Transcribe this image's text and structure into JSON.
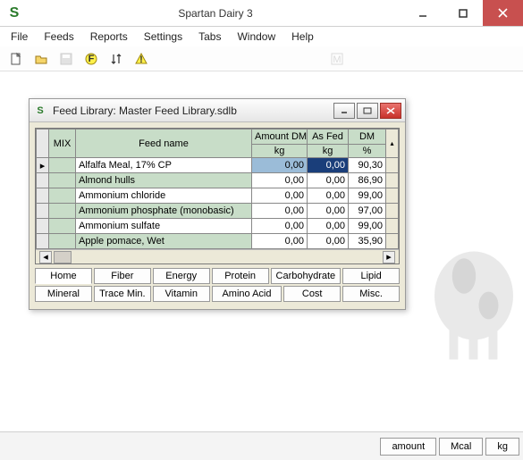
{
  "app": {
    "title": "Spartan Dairy 3",
    "logo": "S"
  },
  "menu": [
    "File",
    "Feeds",
    "Reports",
    "Settings",
    "Tabs",
    "Window",
    "Help"
  ],
  "child": {
    "title": "Feed Library:  Master Feed Library.sdlb",
    "headers": {
      "mix": "MIX",
      "feedname": "Feed name",
      "amount": "Amount DM",
      "asfed": "As Fed",
      "dm": "DM",
      "unit_kg": "kg",
      "unit_pct": "%"
    },
    "rows": [
      {
        "name": "Alfalfa Meal, 17% CP",
        "amount": "0,00",
        "asfed": "0,00",
        "dm": "90,30",
        "sel": true,
        "marker": "▸"
      },
      {
        "name": "Almond hulls",
        "amount": "0,00",
        "asfed": "0,00",
        "dm": "86,90",
        "alt": true
      },
      {
        "name": "Ammonium chloride",
        "amount": "0,00",
        "asfed": "0,00",
        "dm": "99,00"
      },
      {
        "name": "Ammonium phosphate (monobasic)",
        "amount": "0,00",
        "asfed": "0,00",
        "dm": "97,00",
        "alt": true
      },
      {
        "name": "Ammonium sulfate",
        "amount": "0,00",
        "asfed": "0,00",
        "dm": "99,00"
      },
      {
        "name": "Apple pomace, Wet",
        "amount": "0,00",
        "asfed": "0,00",
        "dm": "35,90",
        "alt": true
      }
    ],
    "tabs1": [
      "Home",
      "Fiber",
      "Energy",
      "Protein",
      "Carbohydrate",
      "Lipid"
    ],
    "tabs2": [
      "Mineral",
      "Trace Min.",
      "Vitamin",
      "Amino Acid",
      "Cost",
      "Misc."
    ]
  },
  "status": {
    "amount": "amount",
    "mcal": "Mcal",
    "kg": "kg"
  }
}
